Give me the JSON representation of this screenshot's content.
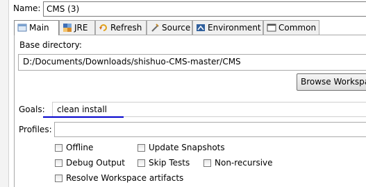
{
  "config": {
    "name_label": "Name:",
    "name_value": "CMS (3)"
  },
  "tabs": [
    {
      "label": "Main",
      "icon": "main-tab-icon",
      "active": true
    },
    {
      "label": "JRE",
      "icon": "jre-icon"
    },
    {
      "label": "Refresh",
      "icon": "refresh-icon"
    },
    {
      "label": "Source",
      "icon": "source-icon"
    },
    {
      "label": "Environment",
      "icon": "environment-icon"
    },
    {
      "label": "Common",
      "icon": "common-icon"
    }
  ],
  "main": {
    "base_directory_label": "Base directory:",
    "base_directory_value": "D:/Documents/Downloads/shishuo-CMS-master/CMS",
    "browse_workspace_label": "Browse Workspace",
    "goals_label": "Goals:",
    "goals_value": "clean install",
    "profiles_label": "Profiles:",
    "profiles_value": "",
    "options": {
      "offline": {
        "label": "Offline",
        "checked": false
      },
      "update_snapshots": {
        "label": "Update Snapshots",
        "checked": false
      },
      "debug_output": {
        "label": "Debug Output",
        "checked": false
      },
      "skip_tests": {
        "label": "Skip Tests",
        "checked": false
      },
      "non_recursive": {
        "label": "Non-recursive",
        "checked": false
      },
      "resolve_workspace": {
        "label": "Resolve Workspace artifacts",
        "checked": false
      }
    }
  },
  "colors": {
    "annotation_underline": "#0000cc",
    "tab_border": "#a8a8a8"
  }
}
